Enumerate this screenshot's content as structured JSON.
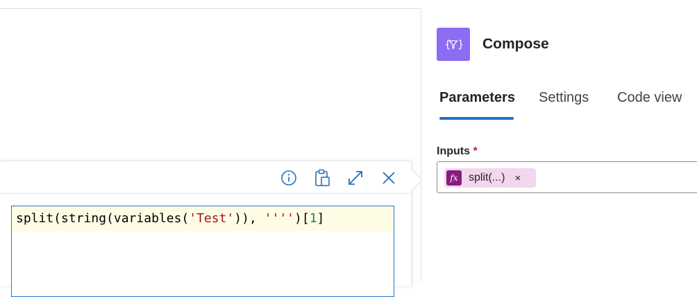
{
  "expression_editor": {
    "info_button": "info-icon",
    "paste_button": "clipboard-icon",
    "expand_button": "expand-icon",
    "close_button": "close-icon",
    "expression": {
      "p1": "split(string(variables(",
      "str1": "'Test'",
      "p2": ")), ",
      "str2": "''''",
      "p3": ")[",
      "num": "1",
      "p4": "]"
    }
  },
  "action": {
    "icon": "compose-icon",
    "icon_color": "#8c6cf2",
    "title": "Compose"
  },
  "tabs": [
    {
      "label": "Parameters",
      "active": true
    },
    {
      "label": "Settings",
      "active": false
    },
    {
      "label": "Code view",
      "active": false
    }
  ],
  "inputs": {
    "label": "Inputs",
    "required_marker": "*",
    "token": {
      "icon": "fx-icon",
      "icon_text": "fx",
      "label": "split(...)",
      "remove": "×",
      "color": "#f2d7ee"
    }
  },
  "colors": {
    "accent": "#1f6fc2",
    "string": "#a31515",
    "number": "#098658"
  }
}
